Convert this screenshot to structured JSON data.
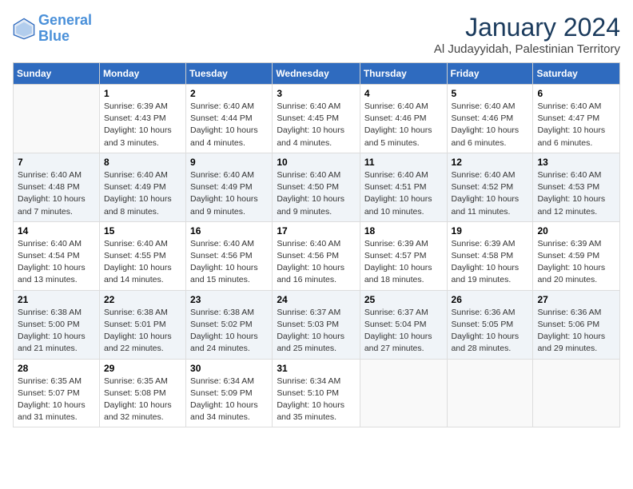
{
  "header": {
    "logo_general": "General",
    "logo_blue": "Blue",
    "month_title": "January 2024",
    "location": "Al Judayyidah, Palestinian Territory"
  },
  "days_of_week": [
    "Sunday",
    "Monday",
    "Tuesday",
    "Wednesday",
    "Thursday",
    "Friday",
    "Saturday"
  ],
  "weeks": [
    [
      {
        "day": "",
        "sunrise": "",
        "sunset": "",
        "daylight": ""
      },
      {
        "day": "1",
        "sunrise": "Sunrise: 6:39 AM",
        "sunset": "Sunset: 4:43 PM",
        "daylight": "Daylight: 10 hours and 3 minutes."
      },
      {
        "day": "2",
        "sunrise": "Sunrise: 6:40 AM",
        "sunset": "Sunset: 4:44 PM",
        "daylight": "Daylight: 10 hours and 4 minutes."
      },
      {
        "day": "3",
        "sunrise": "Sunrise: 6:40 AM",
        "sunset": "Sunset: 4:45 PM",
        "daylight": "Daylight: 10 hours and 4 minutes."
      },
      {
        "day": "4",
        "sunrise": "Sunrise: 6:40 AM",
        "sunset": "Sunset: 4:46 PM",
        "daylight": "Daylight: 10 hours and 5 minutes."
      },
      {
        "day": "5",
        "sunrise": "Sunrise: 6:40 AM",
        "sunset": "Sunset: 4:46 PM",
        "daylight": "Daylight: 10 hours and 6 minutes."
      },
      {
        "day": "6",
        "sunrise": "Sunrise: 6:40 AM",
        "sunset": "Sunset: 4:47 PM",
        "daylight": "Daylight: 10 hours and 6 minutes."
      }
    ],
    [
      {
        "day": "7",
        "sunrise": "Sunrise: 6:40 AM",
        "sunset": "Sunset: 4:48 PM",
        "daylight": "Daylight: 10 hours and 7 minutes."
      },
      {
        "day": "8",
        "sunrise": "Sunrise: 6:40 AM",
        "sunset": "Sunset: 4:49 PM",
        "daylight": "Daylight: 10 hours and 8 minutes."
      },
      {
        "day": "9",
        "sunrise": "Sunrise: 6:40 AM",
        "sunset": "Sunset: 4:49 PM",
        "daylight": "Daylight: 10 hours and 9 minutes."
      },
      {
        "day": "10",
        "sunrise": "Sunrise: 6:40 AM",
        "sunset": "Sunset: 4:50 PM",
        "daylight": "Daylight: 10 hours and 9 minutes."
      },
      {
        "day": "11",
        "sunrise": "Sunrise: 6:40 AM",
        "sunset": "Sunset: 4:51 PM",
        "daylight": "Daylight: 10 hours and 10 minutes."
      },
      {
        "day": "12",
        "sunrise": "Sunrise: 6:40 AM",
        "sunset": "Sunset: 4:52 PM",
        "daylight": "Daylight: 10 hours and 11 minutes."
      },
      {
        "day": "13",
        "sunrise": "Sunrise: 6:40 AM",
        "sunset": "Sunset: 4:53 PM",
        "daylight": "Daylight: 10 hours and 12 minutes."
      }
    ],
    [
      {
        "day": "14",
        "sunrise": "Sunrise: 6:40 AM",
        "sunset": "Sunset: 4:54 PM",
        "daylight": "Daylight: 10 hours and 13 minutes."
      },
      {
        "day": "15",
        "sunrise": "Sunrise: 6:40 AM",
        "sunset": "Sunset: 4:55 PM",
        "daylight": "Daylight: 10 hours and 14 minutes."
      },
      {
        "day": "16",
        "sunrise": "Sunrise: 6:40 AM",
        "sunset": "Sunset: 4:56 PM",
        "daylight": "Daylight: 10 hours and 15 minutes."
      },
      {
        "day": "17",
        "sunrise": "Sunrise: 6:40 AM",
        "sunset": "Sunset: 4:56 PM",
        "daylight": "Daylight: 10 hours and 16 minutes."
      },
      {
        "day": "18",
        "sunrise": "Sunrise: 6:39 AM",
        "sunset": "Sunset: 4:57 PM",
        "daylight": "Daylight: 10 hours and 18 minutes."
      },
      {
        "day": "19",
        "sunrise": "Sunrise: 6:39 AM",
        "sunset": "Sunset: 4:58 PM",
        "daylight": "Daylight: 10 hours and 19 minutes."
      },
      {
        "day": "20",
        "sunrise": "Sunrise: 6:39 AM",
        "sunset": "Sunset: 4:59 PM",
        "daylight": "Daylight: 10 hours and 20 minutes."
      }
    ],
    [
      {
        "day": "21",
        "sunrise": "Sunrise: 6:38 AM",
        "sunset": "Sunset: 5:00 PM",
        "daylight": "Daylight: 10 hours and 21 minutes."
      },
      {
        "day": "22",
        "sunrise": "Sunrise: 6:38 AM",
        "sunset": "Sunset: 5:01 PM",
        "daylight": "Daylight: 10 hours and 22 minutes."
      },
      {
        "day": "23",
        "sunrise": "Sunrise: 6:38 AM",
        "sunset": "Sunset: 5:02 PM",
        "daylight": "Daylight: 10 hours and 24 minutes."
      },
      {
        "day": "24",
        "sunrise": "Sunrise: 6:37 AM",
        "sunset": "Sunset: 5:03 PM",
        "daylight": "Daylight: 10 hours and 25 minutes."
      },
      {
        "day": "25",
        "sunrise": "Sunrise: 6:37 AM",
        "sunset": "Sunset: 5:04 PM",
        "daylight": "Daylight: 10 hours and 27 minutes."
      },
      {
        "day": "26",
        "sunrise": "Sunrise: 6:36 AM",
        "sunset": "Sunset: 5:05 PM",
        "daylight": "Daylight: 10 hours and 28 minutes."
      },
      {
        "day": "27",
        "sunrise": "Sunrise: 6:36 AM",
        "sunset": "Sunset: 5:06 PM",
        "daylight": "Daylight: 10 hours and 29 minutes."
      }
    ],
    [
      {
        "day": "28",
        "sunrise": "Sunrise: 6:35 AM",
        "sunset": "Sunset: 5:07 PM",
        "daylight": "Daylight: 10 hours and 31 minutes."
      },
      {
        "day": "29",
        "sunrise": "Sunrise: 6:35 AM",
        "sunset": "Sunset: 5:08 PM",
        "daylight": "Daylight: 10 hours and 32 minutes."
      },
      {
        "day": "30",
        "sunrise": "Sunrise: 6:34 AM",
        "sunset": "Sunset: 5:09 PM",
        "daylight": "Daylight: 10 hours and 34 minutes."
      },
      {
        "day": "31",
        "sunrise": "Sunrise: 6:34 AM",
        "sunset": "Sunset: 5:10 PM",
        "daylight": "Daylight: 10 hours and 35 minutes."
      },
      {
        "day": "",
        "sunrise": "",
        "sunset": "",
        "daylight": ""
      },
      {
        "day": "",
        "sunrise": "",
        "sunset": "",
        "daylight": ""
      },
      {
        "day": "",
        "sunrise": "",
        "sunset": "",
        "daylight": ""
      }
    ]
  ]
}
